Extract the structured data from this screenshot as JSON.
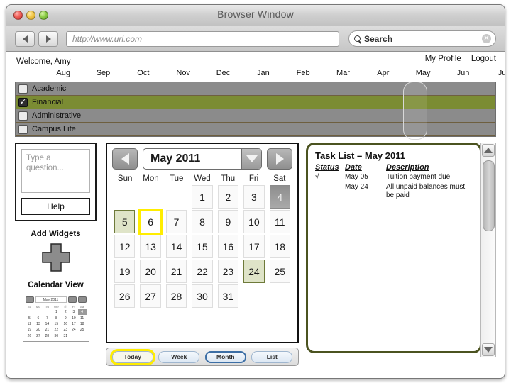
{
  "window": {
    "title": "Browser Window",
    "lights": [
      "close-light",
      "minimize-light",
      "zoom-light"
    ]
  },
  "toolbar": {
    "back_label": "◀",
    "forward_label": "▶",
    "url_value": "http://www.url.com",
    "search_value": "Search",
    "search_clear_label": "✕"
  },
  "account_bar": {
    "welcome": "Welcome, Amy",
    "links": [
      "My Profile",
      "Logout"
    ]
  },
  "timeline": {
    "months": [
      "Aug",
      "Sep",
      "Oct",
      "Nov",
      "Dec",
      "Jan",
      "Feb",
      "Mar",
      "Apr",
      "May",
      "Jun",
      "Jul"
    ],
    "highlighted_month": "May",
    "categories": [
      {
        "label": "Academic",
        "checked": false,
        "check_mark": ""
      },
      {
        "label": "Financial",
        "checked": true,
        "check_mark": "✓"
      },
      {
        "label": "Administrative",
        "checked": false,
        "check_mark": ""
      },
      {
        "label": "Campus Life",
        "checked": false,
        "check_mark": ""
      }
    ],
    "row_color_on": "#7b8c33",
    "row_color_off": "#8b8b8b"
  },
  "sidebar": {
    "question_placeholder": "Type a question...",
    "help_label": "Help",
    "add_widgets_label": "Add Widgets",
    "calendar_view_label": "Calendar View",
    "mini_calendar": {
      "title": "May 2011",
      "dow": [
        "Su",
        "Mo",
        "Tu",
        "We",
        "Th",
        "Fr",
        "Sa"
      ],
      "weeks": [
        [
          "",
          "",
          "",
          "1",
          "2",
          "3",
          "4"
        ],
        [
          "5",
          "6",
          "7",
          "8",
          "9",
          "10",
          "11"
        ],
        [
          "12",
          "13",
          "14",
          "15",
          "16",
          "17",
          "18"
        ],
        [
          "19",
          "20",
          "21",
          "22",
          "23",
          "24",
          "25"
        ],
        [
          "26",
          "27",
          "28",
          "30",
          "31",
          "",
          ""
        ]
      ],
      "selected": "4"
    }
  },
  "calendar": {
    "prev_label": "◀",
    "next_label": "▶",
    "month_value": "May 2011",
    "dropdown_label": "▼",
    "day_names": [
      "Sun",
      "Mon",
      "Tue",
      "Wed",
      "Thu",
      "Fri",
      "Sat"
    ],
    "weeks": [
      [
        "",
        "",
        "",
        "1",
        "2",
        "3",
        "4"
      ],
      [
        "5",
        "6",
        "7",
        "8",
        "9",
        "10",
        "11"
      ],
      [
        "12",
        "13",
        "14",
        "15",
        "16",
        "17",
        "18"
      ],
      [
        "19",
        "20",
        "21",
        "22",
        "23",
        "24",
        "25"
      ],
      [
        "26",
        "27",
        "28",
        "30",
        "31",
        "",
        ""
      ]
    ],
    "today": "4",
    "event_days": [
      "5",
      "24"
    ],
    "focused_day": "6",
    "today_color": "#9a9a9a",
    "event_color": "#dfe4c8",
    "focus_color": "#ffed00"
  },
  "view_buttons": [
    {
      "label": "Today",
      "state": "focused"
    },
    {
      "label": "Week",
      "state": "normal"
    },
    {
      "label": "Month",
      "state": "selected"
    },
    {
      "label": "List",
      "state": "normal"
    }
  ],
  "task_panel": {
    "title": "Task List – May 2011",
    "border_color": "#4b5320",
    "columns": [
      "Status",
      "Date",
      "Description"
    ],
    "rows": [
      {
        "status": "√",
        "date": "May 05",
        "description": "Tuition payment  due"
      },
      {
        "status": "",
        "date": "May 24",
        "description": "All unpaid balances must be paid"
      }
    ]
  },
  "scrollbar": {
    "up_label": "▲",
    "down_label": "▼"
  }
}
